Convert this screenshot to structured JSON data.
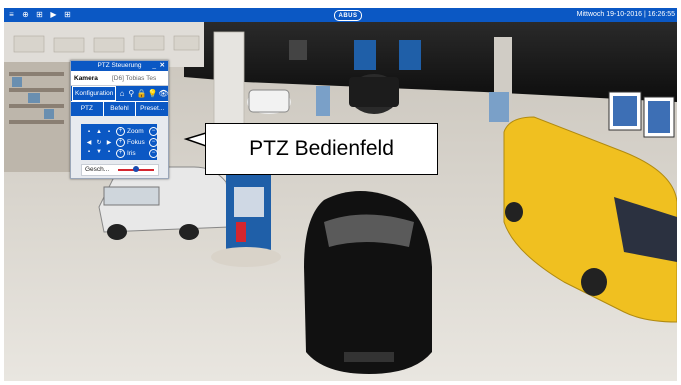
{
  "topbar": {
    "icons": [
      "menu-icon",
      "globe-icon",
      "list-icon",
      "playback-icon",
      "grid-icon"
    ],
    "icon_glyphs": [
      "≡",
      "⊕",
      "⊞",
      "▶",
      "⊞"
    ],
    "logo": "ABUS",
    "datetime": "Mittwoch 19-10-2016 | 16:26:55",
    "color": "#0b58c4"
  },
  "ptz": {
    "title": "PTZ Steuerung",
    "minimize": "_",
    "close": "✕",
    "camera_label": "Kamera",
    "camera_value": "[D6] Tobias Tes",
    "config_label": "Konfiguration",
    "toolbar_icons": [
      "home-icon",
      "search-icon",
      "lock-icon",
      "bulb-icon",
      "eye-icon"
    ],
    "toolbar_glyphs": [
      "⌂",
      "⚲",
      "🔒",
      "💡",
      "👁"
    ],
    "tabs": [
      "PTZ",
      "Befehl",
      "Preset..."
    ],
    "zoom_label": "Zoom",
    "focus_label": "Fokus",
    "iris_label": "Iris",
    "plus": "+",
    "minus": "−",
    "speed_label": "Gesch...",
    "speed_value": 0.5
  },
  "callout": {
    "text": "PTZ Bedienfeld"
  }
}
